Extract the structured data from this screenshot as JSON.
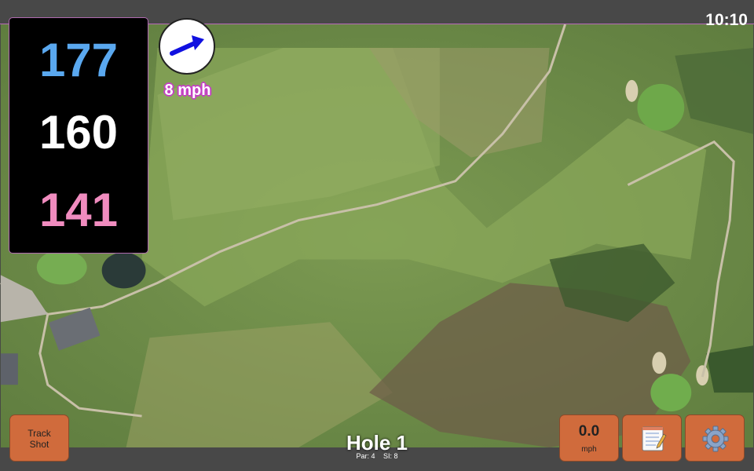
{
  "status_bar": {
    "time": "10:10"
  },
  "distances": {
    "back": "177",
    "middle": "160",
    "front": "141"
  },
  "wind": {
    "speed_label": "8 mph",
    "direction_icon": "wind-arrow-icon",
    "arrow_color": "#1010e0"
  },
  "hole": {
    "title": "Hole 1",
    "par": "Par: 4",
    "stroke_index": "SI: 8"
  },
  "buttons": {
    "track_shot_line1": "Track",
    "track_shot_line2": "Shot",
    "speed_value": "0.0",
    "speed_unit": "mph",
    "notes_icon": "notepad-icon",
    "settings_icon": "gear-icon"
  },
  "colors": {
    "accent_orange": "#d06b3c",
    "distance_back": "#5aa8ef",
    "distance_middle": "#ffffff",
    "distance_front": "#f08cbf",
    "panel_border": "#b06ab0"
  }
}
